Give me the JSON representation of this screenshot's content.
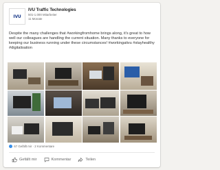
{
  "post": {
    "company": "IVU Traffic Technologies",
    "followers": "501-1.000 Mitarbeiter",
    "age": "11 Monate",
    "logo_text": "IVU",
    "text": "Despite the many challenges that #workingfromhome brings along, it's great to how well our colleagues are handling the current situation. Many thanks to everyone for keeping our business running under these circumstances! #workingativu #stayhealthy #digitalisation"
  },
  "social": {
    "likes": "67 Gefällt mir",
    "separator": "·",
    "comments": "2 Kommentare"
  },
  "actions": {
    "like": "Gefällt mir",
    "comment": "Kommentar",
    "share": "Teilen"
  },
  "icons": {
    "like": "thumbs-up-icon",
    "comment": "comment-bubble-icon",
    "share": "share-arrow-icon"
  },
  "colors": {
    "accent": "#378fe9",
    "logo": "#1a3a8a"
  }
}
